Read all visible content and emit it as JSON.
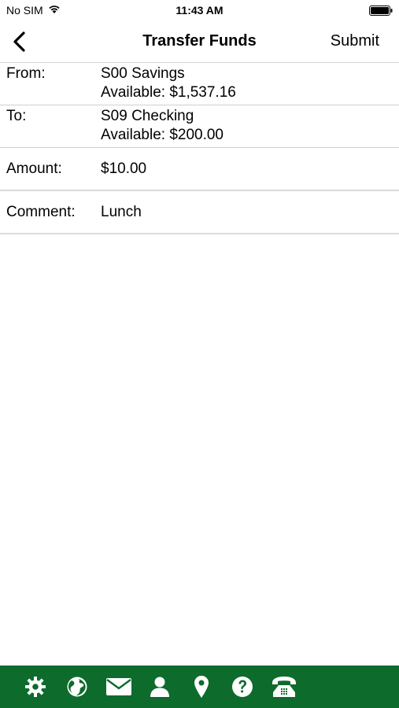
{
  "status_bar": {
    "carrier": "No SIM",
    "time": "11:43 AM"
  },
  "nav": {
    "title": "Transfer Funds",
    "submit_label": "Submit",
    "back_icon": "chevron-left-icon"
  },
  "form": {
    "from": {
      "label": "From:",
      "account": "S00 Savings",
      "available": "Available: $1,537.16"
    },
    "to": {
      "label": "To:",
      "account": "S09 Checking",
      "available": "Available: $200.00"
    },
    "amount": {
      "label": "Amount:",
      "value": "$10.00"
    },
    "comment": {
      "label": "Comment:",
      "value": "Lunch"
    }
  },
  "toolbar": {
    "background": "#0d6b2c",
    "icons": [
      "gear-icon",
      "globe-icon",
      "mail-icon",
      "person-icon",
      "location-pin-icon",
      "help-icon",
      "phone-icon"
    ]
  }
}
